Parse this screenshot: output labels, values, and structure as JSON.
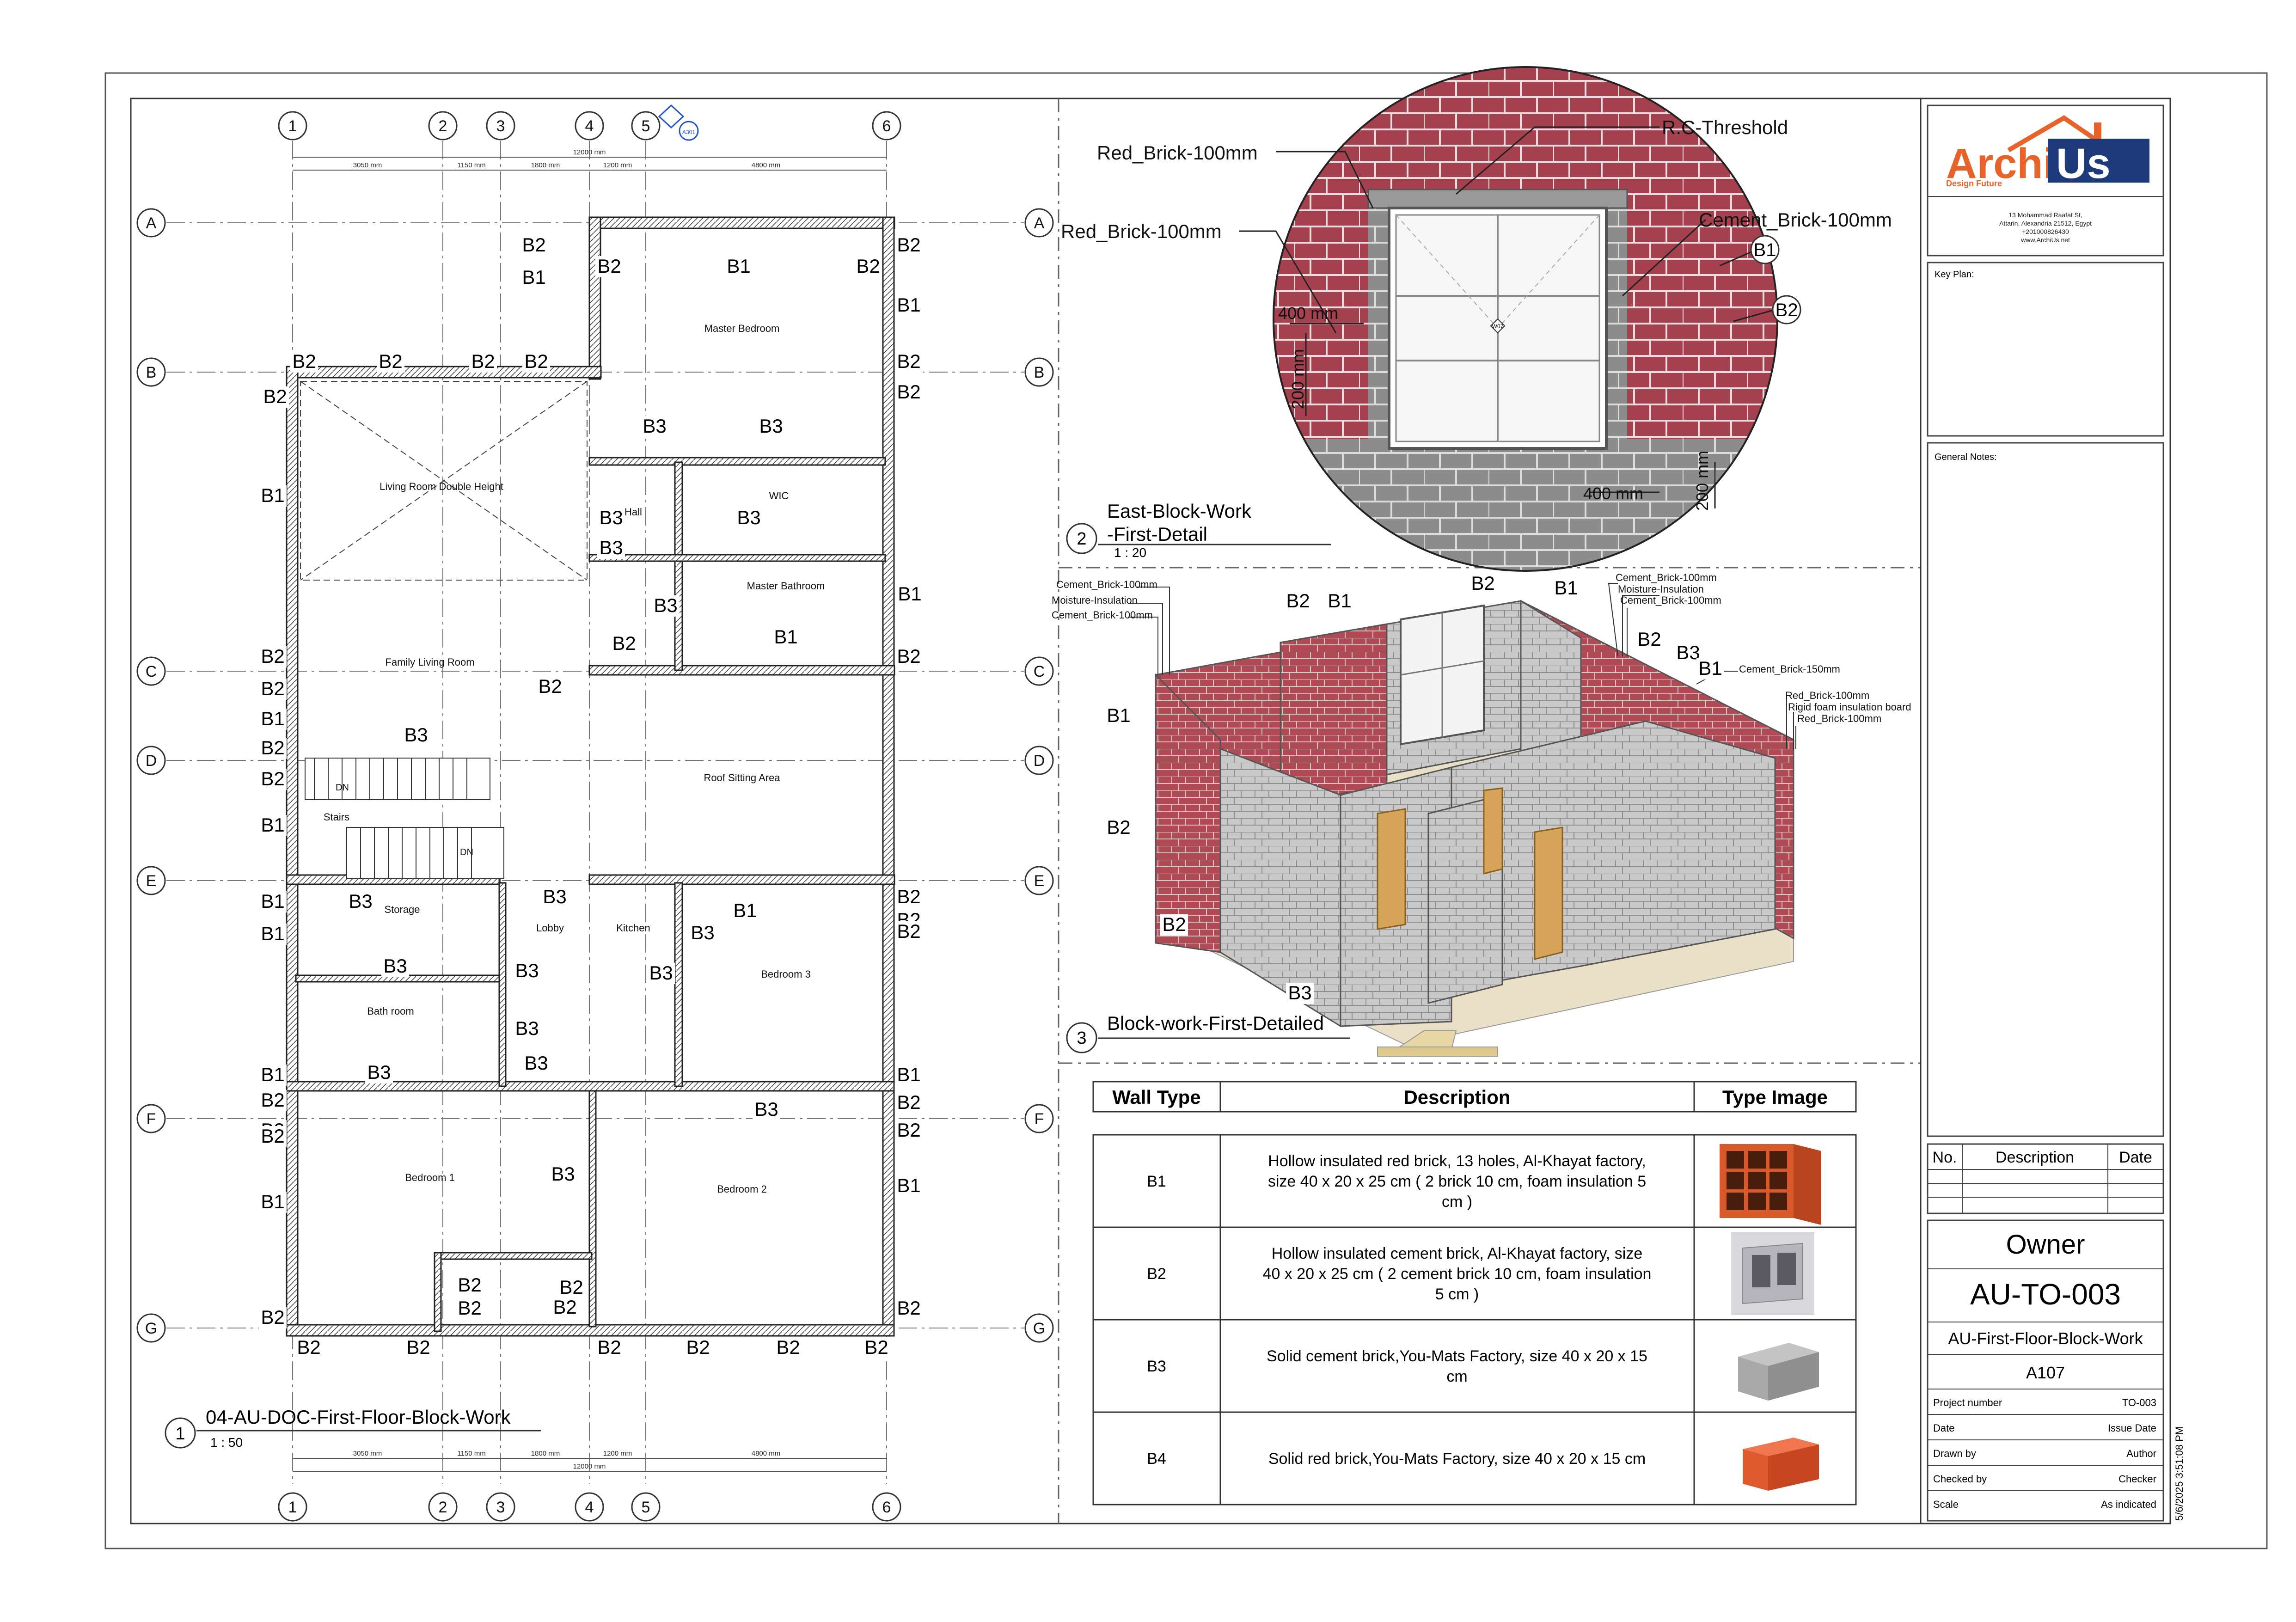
{
  "grid": {
    "cols": [
      "1",
      "2",
      "3",
      "4",
      "5",
      "6"
    ],
    "rows": [
      "A",
      "B",
      "C",
      "D",
      "E",
      "F",
      "G"
    ]
  },
  "plan": {
    "rooms": [
      "Master Bedroom",
      "Living Room Double Height",
      "Hall",
      "WIC",
      "Master Bathroom",
      "Family Living Room",
      "Roof Sitting Area",
      "Stairs",
      "Storage",
      "Lobby",
      "Kitchen",
      "Bedroom 3",
      "Bath room",
      "Bedroom 1",
      "Bedroom 2"
    ],
    "overall_dim": "12000 mm",
    "top_dims": [
      "3050 mm",
      "1150 mm",
      "1800 mm",
      "1200 mm",
      "4800 mm"
    ],
    "bottom_dims": [
      "3050 mm",
      "1150 mm",
      "1800 mm",
      "1200 mm",
      "4800 mm"
    ],
    "stair_labels": [
      "DN",
      "DN"
    ],
    "title": "04-AU-DOC-First-Floor-Block-Work",
    "number": "1",
    "scale": "1 : 50",
    "section_mark": "A301"
  },
  "detail": {
    "labels": {
      "red_brick_1": "Red_Brick-100mm",
      "red_brick_2": "Red_Brick-100mm",
      "threshold": "R.C-Threshold",
      "cement_brick": "Cement_Brick-100mm",
      "dim_400_a": "400 mm",
      "dim_200_a": "200 mm",
      "dim_400_b": "400 mm",
      "dim_200_b": "200 mm",
      "tag_b1": "B1",
      "tag_b2": "B2",
      "window_tag": "W07"
    },
    "title_line1": "East-Block-Work",
    "title_line2": "-First-Detail",
    "number": "2",
    "scale": "1 : 20"
  },
  "iso": {
    "callouts_left": [
      "Cement_Brick-100mm",
      "Moisture-Insulation",
      "Cement_Brick-100mm"
    ],
    "callouts_right_top": [
      "Cement_Brick-100mm",
      "Moisture-Insulation",
      "Cement_Brick-100mm"
    ],
    "callout_cement150": "Cement_Brick-150mm",
    "callouts_right_bottom": [
      "Red_Brick-100mm",
      "Rigid foam insulation board",
      "Red_Brick-100mm"
    ],
    "title": "Block-work-First-Detailed",
    "number": "3"
  },
  "wall_table": {
    "headers": [
      "Wall Type",
      "Description",
      "Type Image"
    ],
    "rows": [
      {
        "type": "B1",
        "desc": "Hollow insulated red brick, 13 holes, Al-Khayat factory, size 40 x 20 x 25 cm ( 2 brick 10 cm, foam insulation 5 cm )",
        "img": "hollow-red-brick"
      },
      {
        "type": "B2",
        "desc": "Hollow insulated cement brick, Al-Khayat factory, size 40 x 20 x 25 cm ( 2 cement brick 10 cm, foam insulation 5 cm )",
        "img": "hollow-cement-brick"
      },
      {
        "type": "B3",
        "desc": "Solid cement brick,You-Mats Factory, size 40 x 20 x 15 cm",
        "img": "solid-cement-brick"
      },
      {
        "type": "B4",
        "desc": "Solid red brick,You-Mats Factory, size 40 x 20 x 15 cm",
        "img": "solid-red-brick"
      }
    ]
  },
  "title_block": {
    "logo_text": "ArchiUs",
    "logo_tagline": "Design Future",
    "address_lines": [
      "13 Mohammad Raafat St,",
      "Attarin, Alexandria 21512, Egypt",
      "+201000826430",
      "www.ArchiUs.net"
    ],
    "key_plan": "Key Plan:",
    "general_notes": "General Notes:",
    "rev_headers": [
      "No.",
      "Description",
      "Date"
    ],
    "owner": "Owner",
    "project_code": "AU-TO-003",
    "sheet_name": "AU-First-Floor-Block-Work",
    "sheet_number": "A107",
    "info": [
      {
        "label": "Project number",
        "value": "TO-003"
      },
      {
        "label": "Date",
        "value": "Issue Date"
      },
      {
        "label": "Drawn by",
        "value": "Author"
      },
      {
        "label": "Checked by",
        "value": "Checker"
      },
      {
        "label": "Scale",
        "value": "As indicated"
      }
    ],
    "timestamp": "5/6/2025 3:51:08 PM"
  },
  "colors": {
    "red_brick": "#a5404f",
    "cement_brick": "#8a8a8a",
    "logo_orange": "#e8632a",
    "logo_blue": "#1d3b7a",
    "window_blue": "#2255cc"
  }
}
